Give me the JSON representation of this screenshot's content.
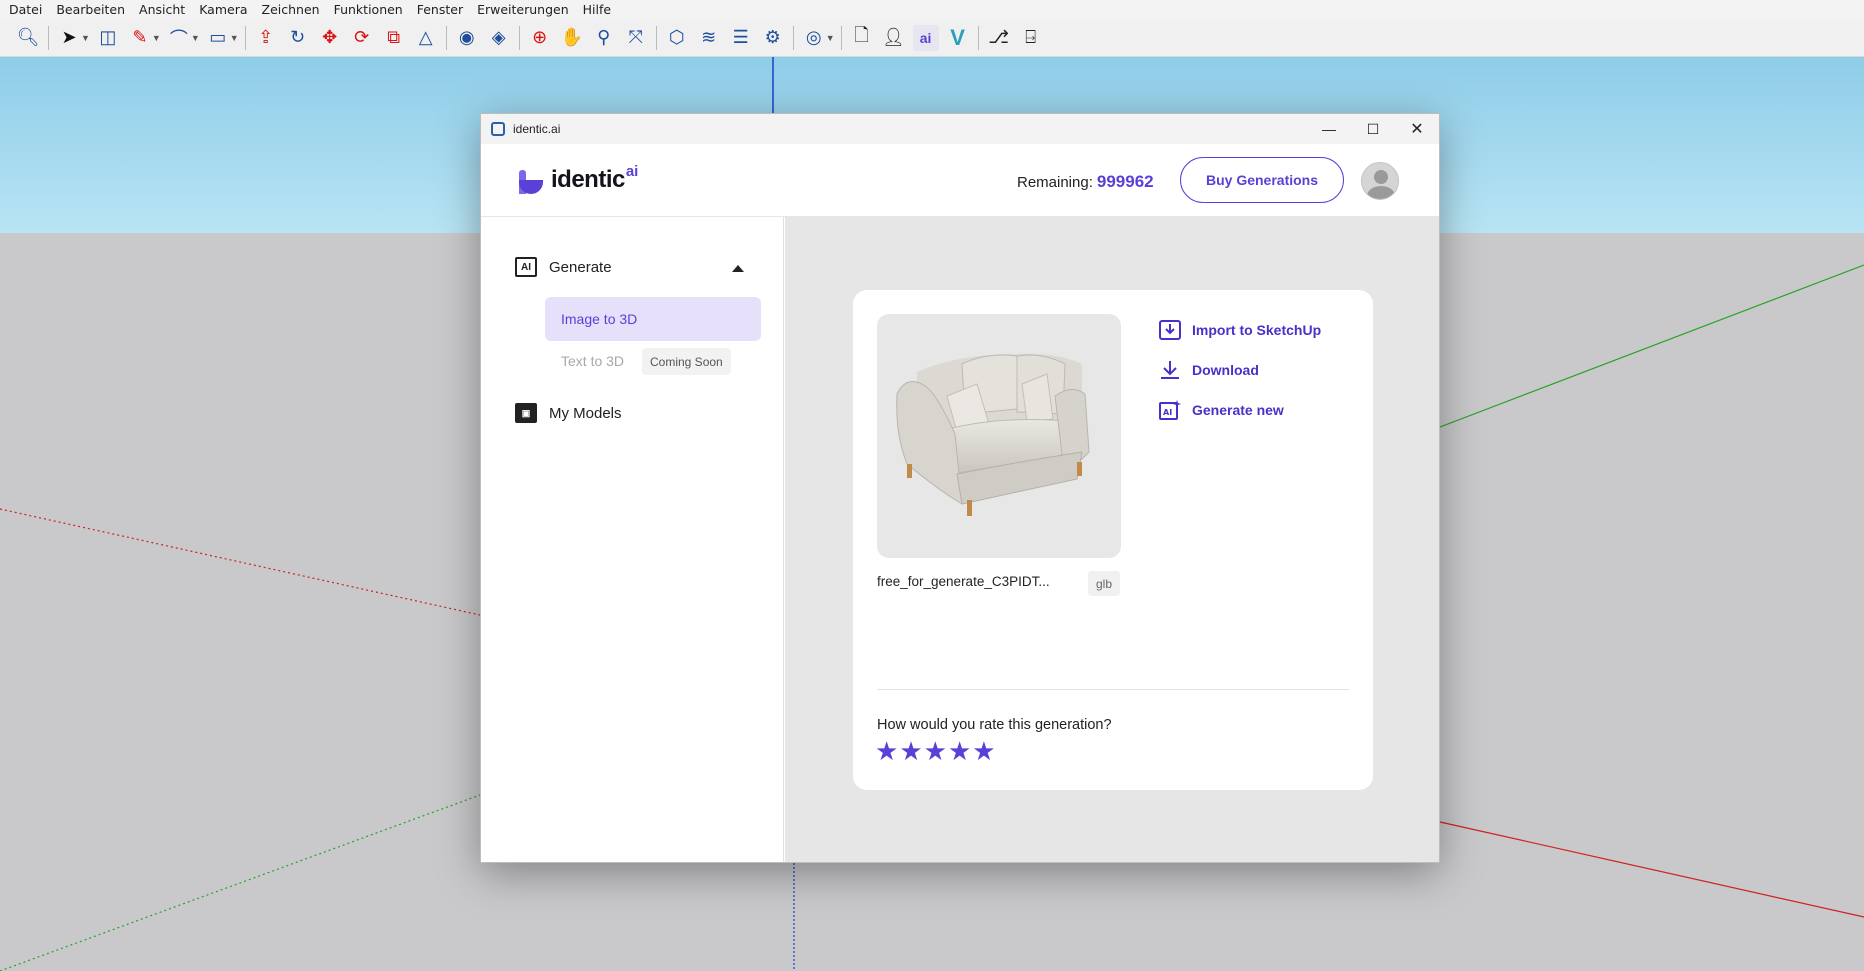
{
  "menubar": [
    "Datei",
    "Bearbeiten",
    "Ansicht",
    "Kamera",
    "Zeichnen",
    "Funktionen",
    "Fenster",
    "Erweiterungen",
    "Hilfe"
  ],
  "window": {
    "title": "identic.ai"
  },
  "header": {
    "logo_text": "identic",
    "logo_sup": "ai",
    "remaining_label": "Remaining:",
    "remaining_value": "999962",
    "buy_label": "Buy Generations"
  },
  "sidebar": {
    "generate_label": "Generate",
    "image_to_3d_label": "Image to 3D",
    "text_to_3d_label": "Text to 3D",
    "coming_soon_label": "Coming Soon",
    "my_models_label": "My Models"
  },
  "card": {
    "file_name": "free_for_generate_C3PIDT...",
    "file_type": "glb",
    "actions": {
      "import_label": "Import to SketchUp",
      "download_label": "Download",
      "generate_new_label": "Generate new"
    },
    "rating_question": "How would you rate this generation?",
    "rating_value": 5,
    "rating_max": 5
  },
  "colors": {
    "accent": "#5b3fd6",
    "accent_light": "#e6e0fb"
  }
}
